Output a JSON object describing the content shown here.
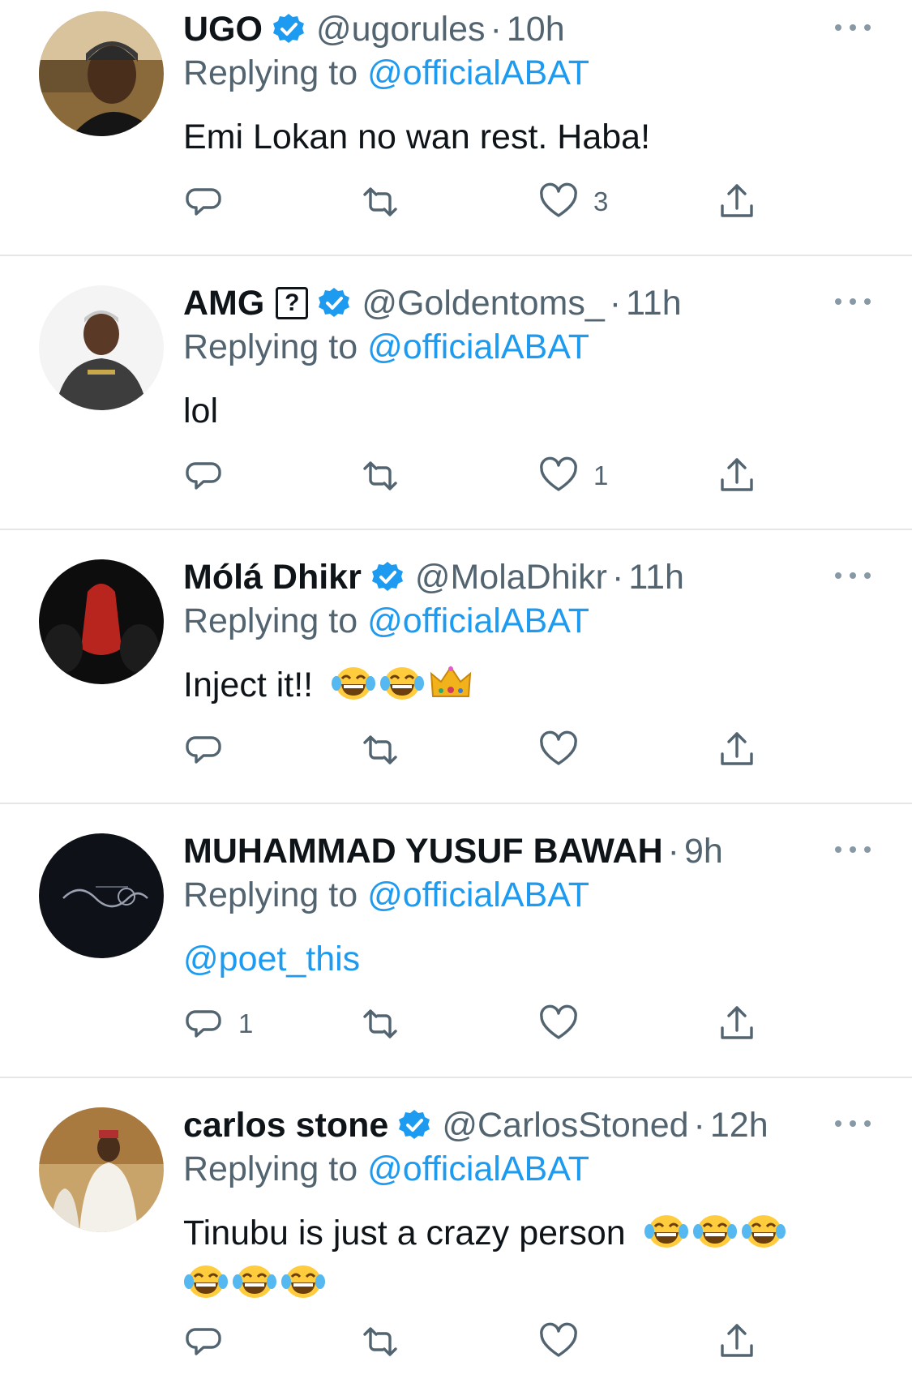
{
  "colors": {
    "link": "#1d9bf0",
    "muted": "#536471",
    "verified": "#1d9bf0",
    "divider": "#e6e6e6"
  },
  "icons": {
    "reply": "reply-icon",
    "retweet": "retweet-icon",
    "like": "like-icon",
    "share": "share-icon",
    "verified": "verified-icon",
    "more": "more-icon"
  },
  "reply_prefix": "Replying to",
  "tweets": [
    {
      "name": "UGO",
      "verified": true,
      "handle": "@ugorules",
      "separator": "·",
      "time": "10h",
      "replying_to": "@officialABAT",
      "text": "Emi Lokan no wan rest. Haba!",
      "counts": {
        "reply": "",
        "retweet": "",
        "like": "3"
      }
    },
    {
      "name": "AMG",
      "badge": "?",
      "verified": true,
      "handle": "@Goldentoms_",
      "separator": "·",
      "time": "11h",
      "replying_to": "@officialABAT",
      "text": "lol",
      "counts": {
        "reply": "",
        "retweet": "",
        "like": "1"
      }
    },
    {
      "name": "Mólá Dhikr",
      "verified": true,
      "handle": "@MolaDhikr",
      "separator": "·",
      "time": "11h",
      "replying_to": "@officialABAT",
      "text": "Inject it!!",
      "emojis": [
        "tears-of-joy",
        "tears-of-joy",
        "crown"
      ],
      "counts": {
        "reply": "",
        "retweet": "",
        "like": ""
      }
    },
    {
      "name": "MUHAMMAD YUSUF BAWAH",
      "verified": false,
      "handle": "",
      "separator": "·",
      "time": "9h",
      "replying_to": "@officialABAT",
      "text": "@poet_this",
      "counts": {
        "reply": "1",
        "retweet": "",
        "like": ""
      }
    },
    {
      "name": "carlos stone",
      "verified": true,
      "handle": "@CarlosStoned",
      "separator": "·",
      "time": "12h",
      "replying_to": "@officialABAT",
      "text": "Tinubu is just a crazy person",
      "emojis": [
        "tears-of-joy",
        "tears-of-joy",
        "tears-of-joy",
        "tears-of-joy",
        "tears-of-joy",
        "tears-of-joy"
      ],
      "counts": {
        "reply": "",
        "retweet": "",
        "like": ""
      }
    }
  ]
}
